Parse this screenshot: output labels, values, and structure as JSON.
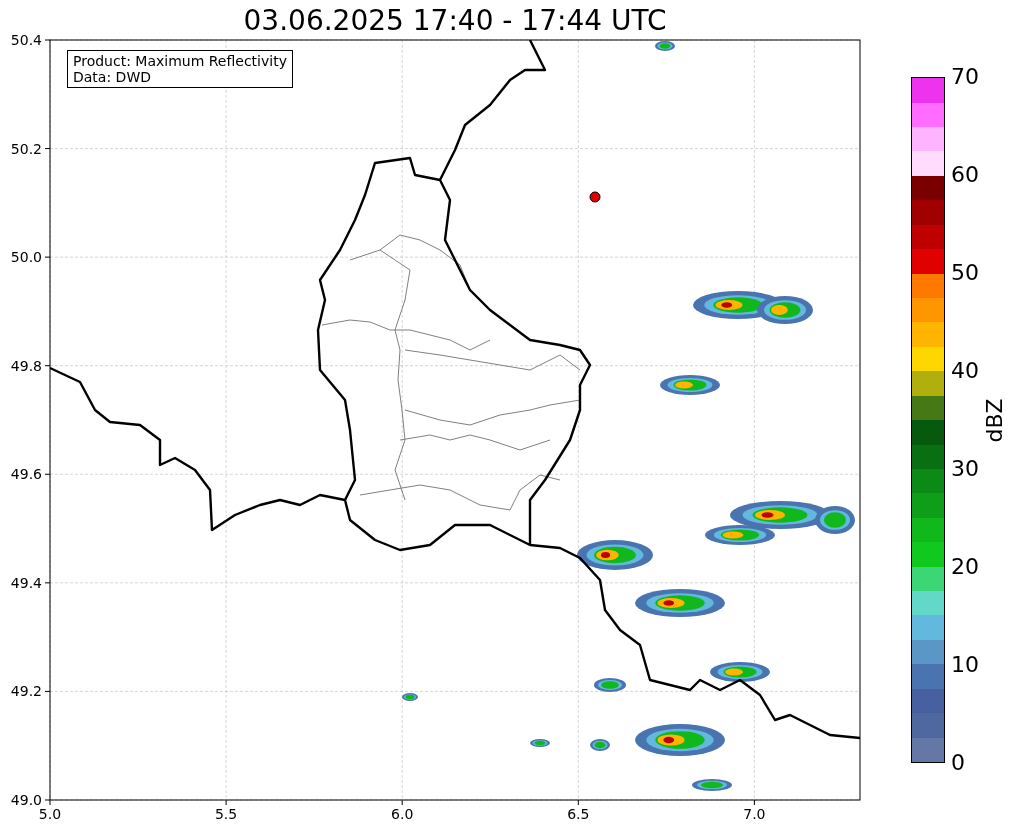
{
  "title": "03.06.2025 17:40 - 17:44 UTC",
  "info_box": {
    "lines": [
      "Product: Maximum Reflectivity",
      "Data: DWD"
    ]
  },
  "x_ticks": [
    "5.0",
    "5.5",
    "6.0",
    "6.5",
    "7.0"
  ],
  "y_ticks": [
    "50.4",
    "50.2",
    "50.0",
    "49.8",
    "49.6",
    "49.4",
    "49.2",
    "49.0"
  ],
  "colorbar": {
    "label": "dBZ",
    "ticks": [
      "70",
      "60",
      "50",
      "40",
      "30",
      "20",
      "10",
      "0"
    ],
    "bands": [
      {
        "color": "#6577a5"
      },
      {
        "color": "#5068a0"
      },
      {
        "color": "#4660a0"
      },
      {
        "color": "#4a74b0"
      },
      {
        "color": "#5a96c6"
      },
      {
        "color": "#62b8dd"
      },
      {
        "color": "#62d8c8"
      },
      {
        "color": "#3dd676"
      },
      {
        "color": "#10c81e"
      },
      {
        "color": "#10b81c"
      },
      {
        "color": "#0f9e18"
      },
      {
        "color": "#0b8a15"
      },
      {
        "color": "#087012"
      },
      {
        "color": "#075a0d"
      },
      {
        "color": "#467815"
      },
      {
        "color": "#afaf0e"
      },
      {
        "color": "#ffd700"
      },
      {
        "color": "#ffb400"
      },
      {
        "color": "#ff9600"
      },
      {
        "color": "#ff7800"
      },
      {
        "color": "#e00000"
      },
      {
        "color": "#c00000"
      },
      {
        "color": "#a00000"
      },
      {
        "color": "#7a0000"
      },
      {
        "color": "#ffdcff"
      },
      {
        "color": "#ffb4ff"
      },
      {
        "color": "#ff6cff"
      },
      {
        "color": "#ee33ee"
      }
    ]
  }
}
